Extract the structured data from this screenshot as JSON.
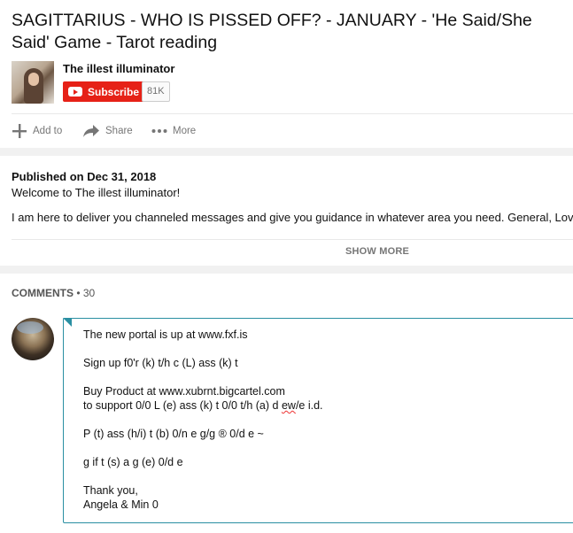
{
  "video": {
    "title": "SAGITTARIUS - WHO IS PISSED OFF? - JANUARY - 'He Said/She Said' Game - Tarot reading"
  },
  "channel": {
    "name": "The illest illuminator",
    "subscribe_label": "Subscribe",
    "subscriber_count": "81K"
  },
  "actions": {
    "add_to": "Add to",
    "share": "Share",
    "more": "More"
  },
  "description": {
    "published": "Published on Dec 31, 2018",
    "welcome": "Welcome to The illest illuminator!",
    "body_line": "I am here to deliver you channeled messages and give you guidance in whatever area you need. General, Love,",
    "show_more": "SHOW MORE"
  },
  "comments": {
    "label": "COMMENTS",
    "count": "• 30",
    "input_lines": {
      "l1": "The new portal is up at www.fxf.is",
      "l2": "Sign up f0'r (k) t/h c (L) ass (k) t",
      "l3a": "Buy Product at www.xubrnt.bigcartel.com",
      "l3b_pre": "to support 0/0 L (e) ass (k) t 0/0 t/h (a) d ",
      "l3b_err": "ew",
      "l3b_post": "/e i.d.",
      "l4": "P (t) ass (h/i) t (b) 0/n e g/g ® 0/d e ~",
      "l5": "g if t (s) a g (e) 0/d e",
      "l6a": "Thank you,",
      "l6b": "Angela & Min 0"
    }
  }
}
